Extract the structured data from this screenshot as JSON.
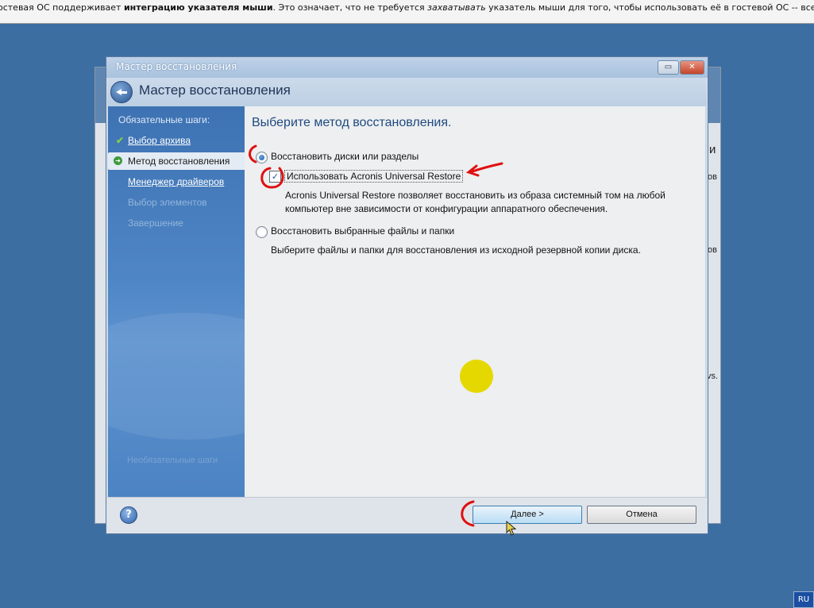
{
  "topbar": {
    "p1": "остевая ОС поддерживает ",
    "p2": "интеграцию указателя мыши",
    "p3": ". Это означает, что не требуется ",
    "p4": "захватывать",
    "p5": " указатель мыши для того, чтобы использовать её в гостевой ОС -- все действия с мышью,"
  },
  "background_window": {
    "frag1": "и",
    "frag2": "ов",
    "frag3": "ов",
    "frag4": "vs."
  },
  "window": {
    "title": "Мастер восстановления",
    "restore_glyph": "▭",
    "close_glyph": "✕",
    "header_title": "Мастер восстановления"
  },
  "steps": {
    "heading": "Обязательные шаги:",
    "items": [
      {
        "label": "Выбор архива",
        "state": "done"
      },
      {
        "label": "Метод восстановления",
        "state": "current"
      },
      {
        "label": "Менеджер драйверов",
        "state": "link"
      },
      {
        "label": "Выбор элементов",
        "state": "disabled"
      },
      {
        "label": "Завершение",
        "state": "disabled"
      }
    ],
    "check_glyph": "✔",
    "arrow_glyph": "➜",
    "footer": "Необязательные шаги"
  },
  "content": {
    "title": "Выберите метод восстановления.",
    "option1": {
      "label": "Восстановить диски или разделы",
      "selected": true
    },
    "checkbox": {
      "label": "Использовать Acronis Universal Restore",
      "checked": true,
      "mark": "✓",
      "desc_line1": "Acronis Universal Restore позволяет восстановить из образа системный том на любой",
      "desc_line2": "компьютер вне зависимости от конфигурации аппаратного обеспечения."
    },
    "option2": {
      "label": "Восстановить выбранные файлы и папки",
      "selected": false,
      "desc": "Выберите файлы и папки для восстановления из исходной резервной копии диска."
    }
  },
  "buttons": {
    "help": "?",
    "next": "Далее >",
    "cancel": "Отмена"
  },
  "taskbar": {
    "language": "RU"
  },
  "colors": {
    "desktop": "#3d6ea2",
    "annotation": "#e01010",
    "highlight_dot": "#e5d800"
  }
}
